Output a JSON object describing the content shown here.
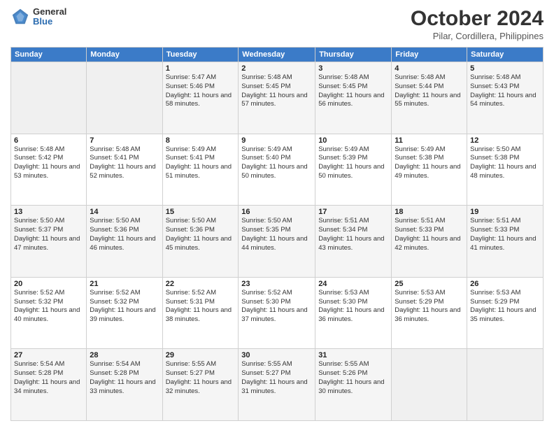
{
  "logo": {
    "general": "General",
    "blue": "Blue"
  },
  "header": {
    "month": "October 2024",
    "location": "Pilar, Cordillera, Philippines"
  },
  "weekdays": [
    "Sunday",
    "Monday",
    "Tuesday",
    "Wednesday",
    "Thursday",
    "Friday",
    "Saturday"
  ],
  "weeks": [
    [
      {
        "day": "",
        "detail": ""
      },
      {
        "day": "",
        "detail": ""
      },
      {
        "day": "1",
        "detail": "Sunrise: 5:47 AM\nSunset: 5:46 PM\nDaylight: 11 hours and 58 minutes."
      },
      {
        "day": "2",
        "detail": "Sunrise: 5:48 AM\nSunset: 5:45 PM\nDaylight: 11 hours and 57 minutes."
      },
      {
        "day": "3",
        "detail": "Sunrise: 5:48 AM\nSunset: 5:45 PM\nDaylight: 11 hours and 56 minutes."
      },
      {
        "day": "4",
        "detail": "Sunrise: 5:48 AM\nSunset: 5:44 PM\nDaylight: 11 hours and 55 minutes."
      },
      {
        "day": "5",
        "detail": "Sunrise: 5:48 AM\nSunset: 5:43 PM\nDaylight: 11 hours and 54 minutes."
      }
    ],
    [
      {
        "day": "6",
        "detail": "Sunrise: 5:48 AM\nSunset: 5:42 PM\nDaylight: 11 hours and 53 minutes."
      },
      {
        "day": "7",
        "detail": "Sunrise: 5:48 AM\nSunset: 5:41 PM\nDaylight: 11 hours and 52 minutes."
      },
      {
        "day": "8",
        "detail": "Sunrise: 5:49 AM\nSunset: 5:41 PM\nDaylight: 11 hours and 51 minutes."
      },
      {
        "day": "9",
        "detail": "Sunrise: 5:49 AM\nSunset: 5:40 PM\nDaylight: 11 hours and 50 minutes."
      },
      {
        "day": "10",
        "detail": "Sunrise: 5:49 AM\nSunset: 5:39 PM\nDaylight: 11 hours and 50 minutes."
      },
      {
        "day": "11",
        "detail": "Sunrise: 5:49 AM\nSunset: 5:38 PM\nDaylight: 11 hours and 49 minutes."
      },
      {
        "day": "12",
        "detail": "Sunrise: 5:50 AM\nSunset: 5:38 PM\nDaylight: 11 hours and 48 minutes."
      }
    ],
    [
      {
        "day": "13",
        "detail": "Sunrise: 5:50 AM\nSunset: 5:37 PM\nDaylight: 11 hours and 47 minutes."
      },
      {
        "day": "14",
        "detail": "Sunrise: 5:50 AM\nSunset: 5:36 PM\nDaylight: 11 hours and 46 minutes."
      },
      {
        "day": "15",
        "detail": "Sunrise: 5:50 AM\nSunset: 5:36 PM\nDaylight: 11 hours and 45 minutes."
      },
      {
        "day": "16",
        "detail": "Sunrise: 5:50 AM\nSunset: 5:35 PM\nDaylight: 11 hours and 44 minutes."
      },
      {
        "day": "17",
        "detail": "Sunrise: 5:51 AM\nSunset: 5:34 PM\nDaylight: 11 hours and 43 minutes."
      },
      {
        "day": "18",
        "detail": "Sunrise: 5:51 AM\nSunset: 5:33 PM\nDaylight: 11 hours and 42 minutes."
      },
      {
        "day": "19",
        "detail": "Sunrise: 5:51 AM\nSunset: 5:33 PM\nDaylight: 11 hours and 41 minutes."
      }
    ],
    [
      {
        "day": "20",
        "detail": "Sunrise: 5:52 AM\nSunset: 5:32 PM\nDaylight: 11 hours and 40 minutes."
      },
      {
        "day": "21",
        "detail": "Sunrise: 5:52 AM\nSunset: 5:32 PM\nDaylight: 11 hours and 39 minutes."
      },
      {
        "day": "22",
        "detail": "Sunrise: 5:52 AM\nSunset: 5:31 PM\nDaylight: 11 hours and 38 minutes."
      },
      {
        "day": "23",
        "detail": "Sunrise: 5:52 AM\nSunset: 5:30 PM\nDaylight: 11 hours and 37 minutes."
      },
      {
        "day": "24",
        "detail": "Sunrise: 5:53 AM\nSunset: 5:30 PM\nDaylight: 11 hours and 36 minutes."
      },
      {
        "day": "25",
        "detail": "Sunrise: 5:53 AM\nSunset: 5:29 PM\nDaylight: 11 hours and 36 minutes."
      },
      {
        "day": "26",
        "detail": "Sunrise: 5:53 AM\nSunset: 5:29 PM\nDaylight: 11 hours and 35 minutes."
      }
    ],
    [
      {
        "day": "27",
        "detail": "Sunrise: 5:54 AM\nSunset: 5:28 PM\nDaylight: 11 hours and 34 minutes."
      },
      {
        "day": "28",
        "detail": "Sunrise: 5:54 AM\nSunset: 5:28 PM\nDaylight: 11 hours and 33 minutes."
      },
      {
        "day": "29",
        "detail": "Sunrise: 5:55 AM\nSunset: 5:27 PM\nDaylight: 11 hours and 32 minutes."
      },
      {
        "day": "30",
        "detail": "Sunrise: 5:55 AM\nSunset: 5:27 PM\nDaylight: 11 hours and 31 minutes."
      },
      {
        "day": "31",
        "detail": "Sunrise: 5:55 AM\nSunset: 5:26 PM\nDaylight: 11 hours and 30 minutes."
      },
      {
        "day": "",
        "detail": ""
      },
      {
        "day": "",
        "detail": ""
      }
    ]
  ]
}
